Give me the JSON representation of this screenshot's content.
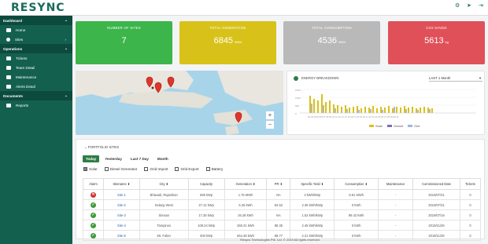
{
  "app": {
    "logo": "RESYNC"
  },
  "topbar": {
    "icons": [
      "settings-icon",
      "send-icon",
      "logout-icon"
    ]
  },
  "sidebar": {
    "sections": [
      {
        "label": "Dashboard",
        "items": [
          {
            "label": "Home",
            "icon": "home-icon"
          },
          {
            "label": "Sites",
            "icon": "location-icon"
          }
        ]
      },
      {
        "label": "Operations",
        "items": [
          {
            "label": "Tickets",
            "icon": "ticket-icon"
          },
          {
            "label": "Team Detail",
            "icon": "team-icon"
          },
          {
            "label": "Maintenance",
            "icon": "wrench-icon"
          },
          {
            "label": "Alerts Detail",
            "icon": "alert-icon"
          }
        ]
      },
      {
        "label": "Documents",
        "items": [
          {
            "label": "Reports",
            "icon": "report-icon"
          }
        ]
      }
    ]
  },
  "cards": [
    {
      "title": "NUMBER OF SITES",
      "value": "7",
      "unit": "",
      "color": "#3cb54a"
    },
    {
      "title": "TOTAL GENERATION",
      "value": "6845",
      "unit": "MWh",
      "color": "#d8c21a"
    },
    {
      "title": "TOTAL CONSUMPTION",
      "value": "4536",
      "unit": "MWh",
      "color": "#b9b9b9"
    },
    {
      "title": "CO2 SAVED",
      "value": "5613",
      "unit": "kg",
      "color": "#e05058"
    }
  ],
  "energy": {
    "title": "ENERGY BREAKDOWN",
    "period": "LAST 1 Month",
    "legend": [
      "Solar",
      "Genset",
      "Grid"
    ]
  },
  "portfolio": {
    "title": "PORTFOLIO SITES",
    "tabs": [
      "Today",
      "Yesterday",
      "Last 7 Day",
      "Month"
    ],
    "filters": [
      {
        "label": "Solar",
        "checked": true
      },
      {
        "label": "Diesel Generator",
        "checked": false
      },
      {
        "label": "Grid Import",
        "checked": false
      },
      {
        "label": "Grid Export",
        "checked": false
      },
      {
        "label": "Battery",
        "checked": false
      }
    ],
    "columns": [
      "Alarm",
      "Sitename",
      "City",
      "Capacity",
      "Generation",
      "PR",
      "Specific Yield",
      "Consumption",
      "Maintenance",
      "Commissioned Date",
      "Tickets"
    ],
    "rows": [
      {
        "alarm": "error",
        "site": "Site-1",
        "city": "Bhiwadi, Rajasthan",
        "capacity": "585 kWp",
        "generation": "1.75 MWh",
        "pr": "NA",
        "yield": "3 kWh/kWp",
        "consumption": "8.81 MWh",
        "maintenance": "-",
        "date": "2019/07/31",
        "tickets": "0"
      },
      {
        "alarm": "ok",
        "site": "Site-2",
        "city": "Kalang West",
        "capacity": "27.12 kWp",
        "generation": "6.25 kWh",
        "pr": "84.52",
        "yield": "2.36 kWh/kWp",
        "consumption": "0 kWh",
        "maintenance": "-",
        "date": "2019/07/31",
        "tickets": "0"
      },
      {
        "alarm": "ok",
        "site": "Site-3",
        "city": "Simsan",
        "capacity": "17.28 kWp",
        "generation": "26.28 kWh",
        "pr": "NA",
        "yield": "1.52 kWh/kWp",
        "consumption": "99.42 kWh",
        "maintenance": "-",
        "date": "2019/07/16",
        "tickets": "0"
      },
      {
        "alarm": "ok",
        "site": "Site-4",
        "city": "Tampines",
        "capacity": "108.24 kWp",
        "generation": "265.31 kWh",
        "pr": "88.35",
        "yield": "2.45 kWh/kWp",
        "consumption": "0 kWh",
        "maintenance": "-",
        "date": "2019/11/29",
        "tickets": "0"
      },
      {
        "alarm": "ok",
        "site": "Site-5",
        "city": "Mt. Faber",
        "capacity": "300 kWp",
        "generation": "664.38 kWh",
        "pr": "88.77",
        "yield": "2.21 kWh/kWp",
        "consumption": "0 kWh",
        "maintenance": "-",
        "date": "2019/11/29",
        "tickets": "0"
      }
    ]
  },
  "footer": {
    "text": "Resync Technologies Pte. Ltd. © 2019 All rights reserved."
  }
}
